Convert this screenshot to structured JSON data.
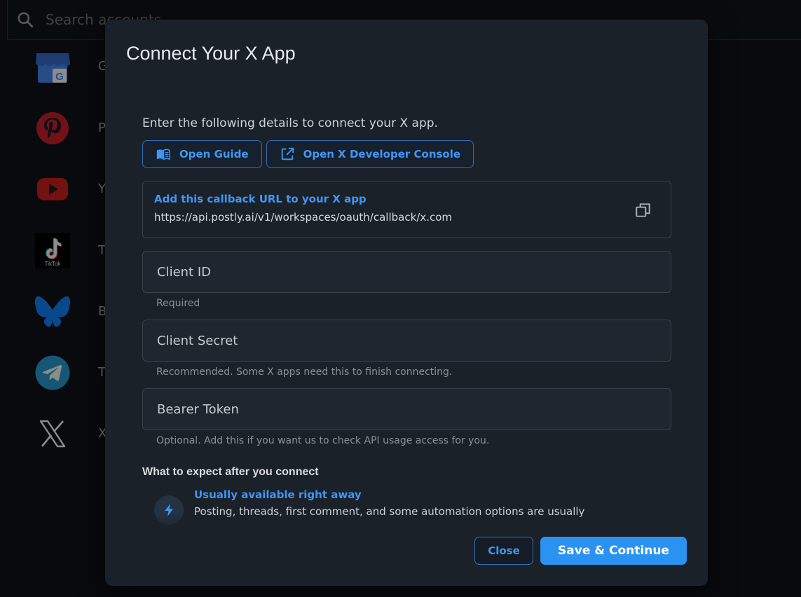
{
  "search": {
    "placeholder": "Search accounts"
  },
  "accounts": [
    {
      "icon": "google-business-icon",
      "letter": "G"
    },
    {
      "icon": "pinterest-icon",
      "letter": "P"
    },
    {
      "icon": "youtube-icon",
      "letter": "Y"
    },
    {
      "icon": "tiktok-icon",
      "letter": "T",
      "caption": "TikTok"
    },
    {
      "icon": "bluesky-icon",
      "letter": "B"
    },
    {
      "icon": "telegram-icon",
      "letter": "T"
    },
    {
      "icon": "x-icon",
      "letter": "X"
    }
  ],
  "modal": {
    "title": "Connect Your X App",
    "intro": "Enter the following details to connect your X app.",
    "open_guide": "Open Guide",
    "open_console": "Open X Developer Console",
    "callback": {
      "title": "Add this callback URL to your X app",
      "url": "https://api.postly.ai/v1/workspaces/oauth/callback/x.com"
    },
    "fields": [
      {
        "placeholder": "Client ID",
        "helper": "Required"
      },
      {
        "placeholder": "Client Secret",
        "helper": "Recommended. Some X apps need this to finish connecting."
      },
      {
        "placeholder": "Bearer Token",
        "helper": "Optional. Add this if you want us to check API usage access for you."
      }
    ],
    "expect_title": "What to expect after you connect",
    "expect_items": [
      {
        "title": "Usually available right away",
        "desc": "Posting, threads, first comment, and some automation options are usually"
      }
    ],
    "close_label": "Close",
    "save_label": "Save & Continue"
  },
  "colors": {
    "accent": "#2a93f2",
    "accent_text": "#3f97f5",
    "modal_bg": "#1b2129"
  }
}
